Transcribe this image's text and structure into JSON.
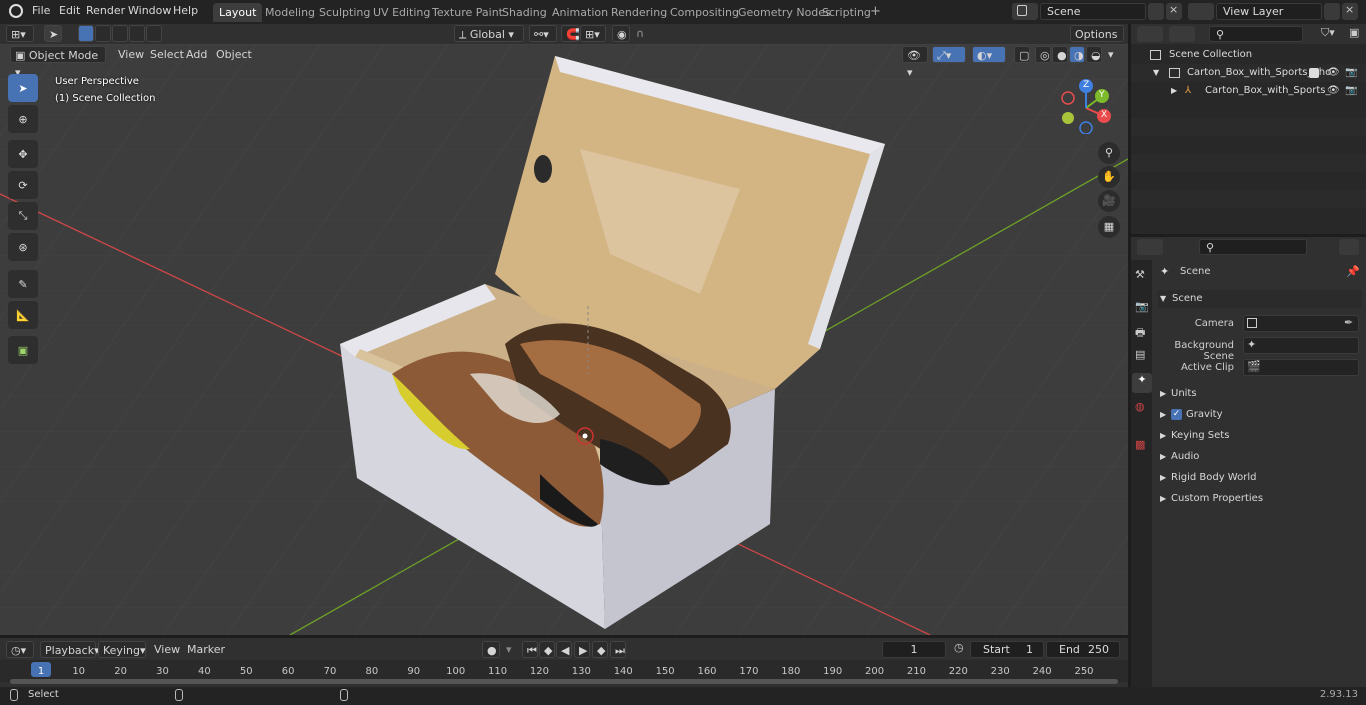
{
  "menus": [
    "File",
    "Edit",
    "Render",
    "Window",
    "Help"
  ],
  "workspaces": [
    "Layout",
    "Modeling",
    "Sculpting",
    "UV Editing",
    "Texture Paint",
    "Shading",
    "Animation",
    "Rendering",
    "Compositing",
    "Geometry Nodes",
    "Scripting"
  ],
  "active_workspace": "Layout",
  "scene_name": "Scene",
  "view_layer": "View Layer",
  "viewport": {
    "mode": "Object Mode",
    "menu": [
      "View",
      "Select",
      "Add",
      "Object"
    ],
    "orientation": "Global",
    "options_label": "Options",
    "overlay_line1": "User Perspective",
    "overlay_line2": "(1) Scene Collection",
    "gizmo": {
      "x": "X",
      "y": "Y",
      "z": "Z"
    }
  },
  "outliner": {
    "root": "Scene Collection",
    "items": [
      "Carton_Box_with_Sports_Sho",
      "Carton_Box_with_Sports_"
    ]
  },
  "properties": {
    "context": "Scene",
    "panel": "Scene",
    "fields": [
      "Camera",
      "Background Scene",
      "Active Clip"
    ],
    "subpanels": [
      "Units",
      "Gravity",
      "Keying Sets",
      "Audio",
      "Rigid Body World",
      "Custom Properties"
    ]
  },
  "timeline": {
    "menus": [
      "Playback",
      "Keying",
      "View",
      "Marker"
    ],
    "current_frame": "1",
    "start_label": "Start",
    "start": "1",
    "end_label": "End",
    "end": "250",
    "ticks": [
      "1",
      "10",
      "20",
      "30",
      "40",
      "50",
      "60",
      "70",
      "80",
      "90",
      "100",
      "110",
      "120",
      "130",
      "140",
      "150",
      "160",
      "170",
      "180",
      "190",
      "200",
      "210",
      "220",
      "230",
      "240",
      "250"
    ]
  },
  "status": {
    "left": "Select",
    "version": "2.93.13"
  },
  "colors": {
    "accent": "#4772b3",
    "axis_x": "#e94c4c",
    "axis_y": "#7dbb2a",
    "axis_z": "#3f7fe0",
    "box": "#d5d6de",
    "box_inside": "#d7b88a"
  }
}
